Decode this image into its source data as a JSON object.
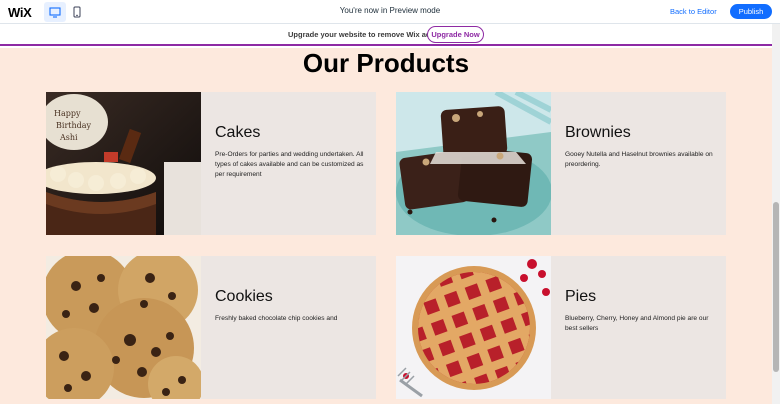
{
  "toolbar": {
    "logo": "WiX",
    "preview_message": "You're now in Preview mode",
    "back_label": "Back to Editor",
    "publish_label": "Publish"
  },
  "banner": {
    "message": "Upgrade your website to remove Wix ads",
    "upgrade_label": "Upgrade Now"
  },
  "main": {
    "heading": "Our Products",
    "products": [
      {
        "title": "Cakes",
        "description": "Pre-Orders for parties and wedding undertaken. All types of cakes available and can be customized as per requirement",
        "image": "chocolate-birthday-cake-photo"
      },
      {
        "title": "Brownies",
        "description": "Gooey Nutella and Haselnut brownies available on preordering.",
        "image": "brownies-photo"
      },
      {
        "title": "Cookies",
        "description": "Freshly baked chocolate chip cookies and",
        "image": "chocolate-chip-cookies-photo"
      },
      {
        "title": "Pies",
        "description": "Blueberry, Cherry, Honey and Almond pie are our best sellers",
        "image": "cherry-lattice-pie-photo"
      }
    ]
  },
  "colors": {
    "page_background": "#fde9dd",
    "card_background": "#ece6e3",
    "accent_blue": "#116dff",
    "upgrade_purple": "#8e2aa4"
  }
}
